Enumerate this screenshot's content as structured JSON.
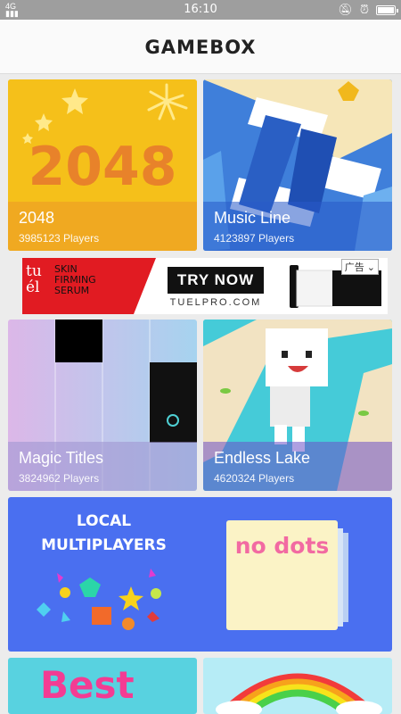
{
  "status": {
    "time": "16:10",
    "signal": "4G"
  },
  "header": {
    "title": "GAMEBOX"
  },
  "games": [
    {
      "name": "2048",
      "players": "3985123 Players",
      "art": "2048"
    },
    {
      "name": "Music Line",
      "players": "4123897 Players"
    },
    {
      "name": "Magic Titles",
      "players": "3824962 Players"
    },
    {
      "name": "Endless Lake",
      "players": "4620324 Players"
    }
  ],
  "ad": {
    "brand": "tu él",
    "line1": "SKIN",
    "line2": "FIRMING",
    "line3": "SERUM",
    "cta": "TRY NOW",
    "url": "TUELPRO.COM",
    "tag": "广告"
  },
  "banner": {
    "line1": "LOCAL",
    "line2": "MULTIPLAYERS",
    "preview": "no dots"
  },
  "bottom_cards": [
    {
      "art_text": "Best"
    }
  ],
  "colors": {
    "blue_banner": "#4a6ff0",
    "yellow": "#f5c518",
    "status": "#9e9e9e"
  }
}
